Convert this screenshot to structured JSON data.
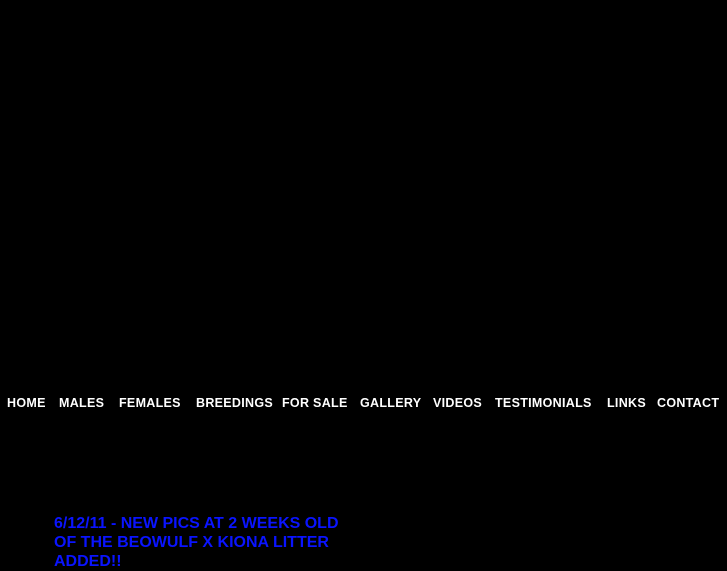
{
  "nav": {
    "items": [
      {
        "label": "HOME"
      },
      {
        "label": "MALES"
      },
      {
        "label": "FEMALES"
      },
      {
        "label": "BREEDINGS"
      },
      {
        "label": "FOR SALE"
      },
      {
        "label": "GALLERY"
      },
      {
        "label": "VIDEOS"
      },
      {
        "label": "TESTIMONIALS"
      },
      {
        "label": "LINKS"
      },
      {
        "label": "CONTACT"
      }
    ]
  },
  "news": {
    "text": "6/12/11 - NEW PICS AT 2 WEEKS OLD OF THE BEOWULF X KIONA LITTER ADDED!!"
  },
  "colors": {
    "background": "#000000",
    "nav_text": "#ffffff",
    "news_text": "#0a14ff"
  }
}
